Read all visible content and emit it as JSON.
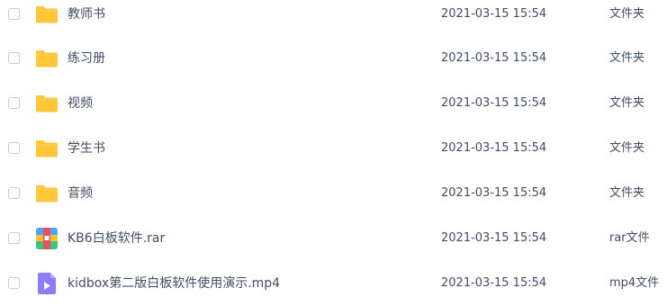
{
  "files": [
    {
      "name": "教师书",
      "date": "2021-03-15 15:54",
      "type": "文件夹",
      "icon": "folder-icon"
    },
    {
      "name": "练习册",
      "date": "2021-03-15 15:54",
      "type": "文件夹",
      "icon": "folder-icon"
    },
    {
      "name": "视频",
      "date": "2021-03-15 15:54",
      "type": "文件夹",
      "icon": "folder-icon"
    },
    {
      "name": "学生书",
      "date": "2021-03-15 15:54",
      "type": "文件夹",
      "icon": "folder-icon"
    },
    {
      "name": "音频",
      "date": "2021-03-15 15:54",
      "type": "文件夹",
      "icon": "folder-icon"
    },
    {
      "name": "KB6白板软件.rar",
      "date": "2021-03-15 15:54",
      "type": "rar文件",
      "icon": "rar-archive-icon"
    },
    {
      "name": "kidbox第二版白板软件使用演示.mp4",
      "date": "2021-03-15 15:54",
      "type": "mp4文件",
      "icon": "video-file-icon"
    }
  ],
  "colors": {
    "text": "#424e67",
    "folder": "#ffc738",
    "checkbox_border": "#c9cdd4",
    "video_icon": "#8c7dff"
  }
}
